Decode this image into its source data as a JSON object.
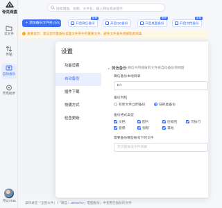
{
  "app": {
    "logo_text": "夸克网盘"
  },
  "sidebar": {
    "items": [
      {
        "label": "云文件",
        "icon": "folder-icon"
      },
      {
        "label": "传输",
        "icon": "transfer-icon"
      },
      {
        "label": "自动备份",
        "icon": "backup-icon",
        "active": true
      },
      {
        "label": "夸克助手",
        "icon": "assistant-icon"
      }
    ],
    "user": {
      "name": "夸父3746"
    }
  },
  "search": {
    "placeholder": "搜索网盘、视频、文件名、输入网址或关键字"
  },
  "toolbar": {
    "primary_label": "添加备份文件夹 (0/5)",
    "tools": [
      {
        "label": "开启微信备份",
        "badge": "推荐"
      },
      {
        "label": "开启QQ备份",
        "badge": ""
      },
      {
        "label": "开启桌面备份",
        "badge": "推荐"
      },
      {
        "label": "开启文档备份",
        "badge": "推荐"
      }
    ]
  },
  "notice": {
    "text": "重要提示：建议您尽量备份桌面文件夹中的重要文件，避免文件丢失或被勒索病毒"
  },
  "breadcrumb": {
    "prefix": "该目录是「全部文件」/「来自：",
    "device": "LENOVO",
    "suffix": "」电脑备份」中查看已备份的文件"
  },
  "settings": {
    "title": "设置",
    "nav": [
      {
        "label": "功能设置",
        "active": false
      },
      {
        "label": "自动备份",
        "active": true
      },
      {
        "label": "插件下载",
        "active": false
      },
      {
        "label": "快捷方式",
        "active": false
      },
      {
        "label": "检查更新",
        "active": false
      }
    ],
    "wechat": {
      "heading": "微信备份",
      "description": "微信中所接收的文件将自动备份到网盘",
      "dir_label": "微信备份本地目录",
      "dir_value": "D:\\",
      "timing_label": "备份时机",
      "timing_options": [
        {
          "label": "有新文件立即备份",
          "selected": false
        },
        {
          "label": "低耗能备份",
          "selected": true
        }
      ],
      "formats_label": "备份格式类型",
      "formats": [
        "文档",
        "图片",
        "压缩包",
        "可执行",
        "音频",
        "视频",
        "其他"
      ],
      "ignore_label": "需要备份哪些账号下的文件",
      "ignore_placeholder": "无识别账号文件目录"
    }
  }
}
